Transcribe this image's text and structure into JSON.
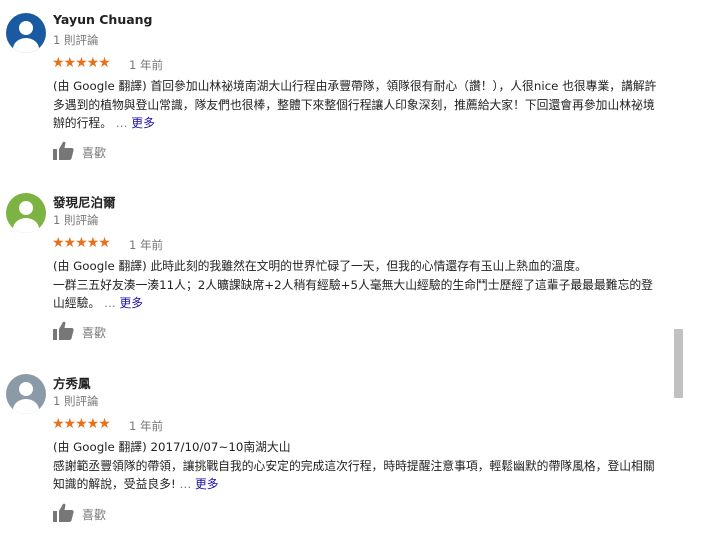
{
  "colors": {
    "star": "#e7711b",
    "link": "#1a0dab",
    "muted": "#777777"
  },
  "reviews": [
    {
      "name": "Yayun Chuang",
      "count": "1 則評論",
      "stars": "★★★★★",
      "date": "1 年前",
      "avatar_color": "#1a5aa0",
      "text": "(由 Google 翻譯) 首回參加山林祕境南湖大山行程由承豐帶隊，領隊很有耐心（讚！），人很nice 也很專業，講解許多遇到的植物與登山常識，隊友們也很棒，整體下來整個行程讓人印象深刻，推薦給大家！下回還會再參加山林祕境辦的行程。",
      "ellipsis": "…",
      "more": "更多",
      "like": "喜歡"
    },
    {
      "name": "發現尼泊爾",
      "count": "1 則評論",
      "stars": "★★★★★",
      "date": "1 年前",
      "avatar_color": "#7cb342",
      "text_line1": "(由 Google 翻譯) 此時此刻的我雖然在文明的世界忙碌了一天，但我的心情還存有玉山上熱血的溫度。",
      "text_line2": "一群三五好友湊一湊11人；2人曠課缺席+2人稍有經驗+5人毫無大山經驗的生命鬥士歷經了這輩子最最最難忘的登山經驗。",
      "ellipsis": "…",
      "more": "更多",
      "like": "喜歡"
    },
    {
      "name": "方秀鳳",
      "count": "1 則評論",
      "stars": "★★★★★",
      "date": "1 年前",
      "avatar_color": "#8a9aa6",
      "text_line1": "(由 Google 翻譯) 2017/10/07~10南湖大山",
      "text_line2": "感謝範丞豐領隊的帶領，讓挑戰自我的心安定的完成這次行程，時時提醒注意事項，輕鬆幽默的帶隊風格，登山相關知識的解說，受益良多!",
      "ellipsis": "…",
      "more": "更多",
      "like": "喜歡"
    }
  ]
}
